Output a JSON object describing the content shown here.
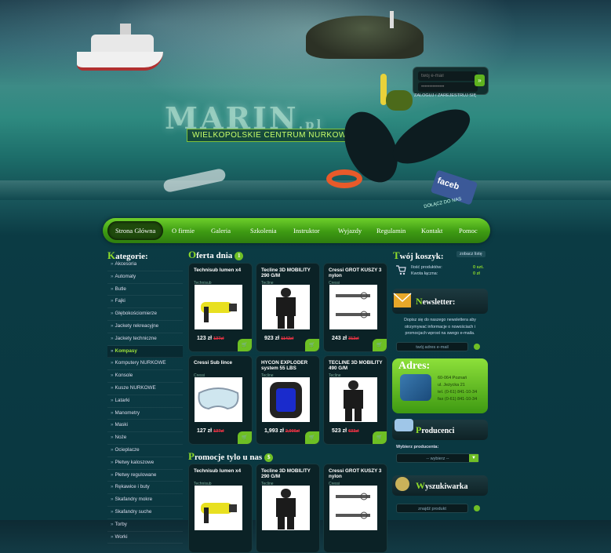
{
  "header": {
    "logo_text": "MARIN",
    "logo_suffix": ".pl",
    "tagline": "WIELKOPOLSKIE CENTRUM NURKOWE",
    "login": {
      "email_placeholder": "twój e-mail",
      "password_placeholder": "••••••••••••••",
      "go_label": "»",
      "links": "ZALOGUJ / ZAREJESTRUJ SIĘ"
    },
    "facebook_label": "faceb",
    "facebook_sub": "DOŁĄCZ DO NAS"
  },
  "nav": {
    "items": [
      "Strona Główna",
      "O firmie",
      "Galeria",
      "Szkolenia",
      "Instruktor",
      "Wyjazdy",
      "Regulamin",
      "Kontakt",
      "Pomoc"
    ]
  },
  "sidebar": {
    "title_first": "K",
    "title_rest": "ategorie:",
    "items": [
      "Akcesoria",
      "Automaty",
      "Butle",
      "Fajki",
      "Głębokościomierze",
      "Jackety rekreacyjne",
      "Jackety techniczne",
      "Kompasy",
      "Komputery NURKOWE",
      "Konsole",
      "Kusze NURKOWE",
      "Latarki",
      "Manometry",
      "Maski",
      "Noże",
      "Ocieplacze",
      "Płetwy kaloszowe",
      "Płetwy regulowane",
      "Rękawice i buty",
      "Skafandry mokre",
      "Skafandry suche",
      "Torby",
      "Worki"
    ],
    "active_index": 7
  },
  "offer": {
    "title_first": "O",
    "title_rest": "ferta dnia",
    "badge": "1",
    "products": [
      {
        "name": "Technisub lumen x4",
        "brand": "Technisub",
        "price": "123 zł",
        "old": "137zł"
      },
      {
        "name": "Tecline 3D MOBILITY 290 G/M",
        "brand": "Tecline",
        "price": "923 zł",
        "old": "1142zł"
      },
      {
        "name": "Cressi GROT KUSZY 3 nylon",
        "brand": "Cressi",
        "price": "243 zł",
        "old": "312zł"
      },
      {
        "name": "Cressi Sub lince",
        "brand": "Cressi",
        "price": "127 zł",
        "old": "137zł"
      },
      {
        "name": "HYCON EXPLODER system 55 LBS",
        "brand": "Tecline",
        "price": "1,993 zł",
        "old": "2,000zł"
      },
      {
        "name": "TECLINE 3D MOBILITY 490 G/M",
        "brand": "Tecline",
        "price": "523 zł",
        "old": "633zł"
      }
    ]
  },
  "promo": {
    "title_first": "P",
    "title_rest": "romocje tylo u nas",
    "badge": "$",
    "products": [
      {
        "name": "Technisub lumen x4",
        "brand": "Technisub"
      },
      {
        "name": "Tecline 3D MOBILITY 290 G/M",
        "brand": "Tecline"
      },
      {
        "name": "Cressi GROT KUSZY 3 nylon",
        "brand": "Cressi"
      }
    ]
  },
  "cart": {
    "title_first": "T",
    "title_rest": "wój koszyk:",
    "button": "zobacz listę",
    "rows": [
      {
        "label": "Ilość produktów:",
        "value": "0 szt."
      },
      {
        "label": "Kwota łączna:",
        "value": "0 zł"
      }
    ]
  },
  "newsletter": {
    "title_first": "N",
    "title_rest": "ewsletter:",
    "text": "Dopisz się do naszego newslettera aby otrzymywać informacje o nowościach i promocjach wprost na swego e-maila.",
    "placeholder": "twój adres e-mail"
  },
  "address": {
    "title": "Adres:",
    "lines": [
      "60-064 Poznań",
      "ul. Jeżycka 21",
      "tel. (0-61) 841-10-34",
      "fax (0-61) 841-10-34"
    ]
  },
  "producers": {
    "title_first": "P",
    "title_rest": "roducenci",
    "label": "Wybierz producenta:",
    "selected": "-- wybierz --"
  },
  "search": {
    "title_first": "W",
    "title_rest": "yszukiwarka",
    "placeholder": "znajdź produkt"
  },
  "colors": {
    "accent": "#8fdc2b",
    "nav_green": "#4caf1a",
    "old_price": "#e34"
  }
}
